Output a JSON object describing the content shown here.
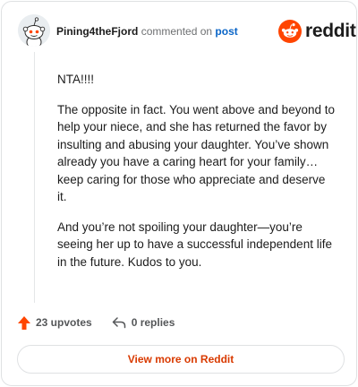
{
  "comment": {
    "username": "Pining4theFjord",
    "action_text": "commented on",
    "post_link": "post",
    "paragraphs": [
      "NTA!!!!",
      "The opposite in fact. You went above and beyond to help your niece, and she has returned the favor by insulting and abusing your daughter. You’ve shown already you have a caring heart for your family…keep caring for those who appreciate and deserve it.",
      "And you’re not spoiling your daughter—you’re seeing her up to have a successful independent life in the future. Kudos to you."
    ]
  },
  "brand": {
    "name": "reddit",
    "color": "#ff4500"
  },
  "actions": {
    "upvotes": "23 upvotes",
    "replies": "0 replies"
  },
  "footer": {
    "view_more": "View more on Reddit"
  },
  "icons": {
    "upvote": "upvote-arrow-icon",
    "reply": "reply-arrow-icon",
    "avatar": "snoo-avatar-icon",
    "logo": "reddit-snoo-icon"
  },
  "colors": {
    "accent": "#d93a00",
    "link": "#0a65c7",
    "upvote": "#ff4500"
  }
}
